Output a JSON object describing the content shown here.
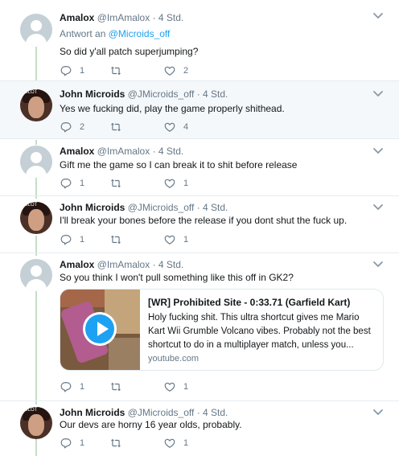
{
  "tweets": [
    {
      "name": "Amalox",
      "handle": "@ImAmalox",
      "time": "· 4 Std.",
      "reply_to_prefix": "Antwort an",
      "reply_to_handle": "@Microids_off",
      "text": "So did y'all patch superjumping?",
      "replies": "1",
      "retweets": "",
      "likes": "2"
    },
    {
      "name": "John Microids",
      "handle": "@JMicroids_off",
      "time": "· 4 Std.",
      "avatar_tag": "TSLOT",
      "text": "Yes we fucking did, play the game properly shithead.",
      "replies": "2",
      "retweets": "",
      "likes": "4"
    },
    {
      "name": "Amalox",
      "handle": "@ImAmalox",
      "time": "· 4 Std.",
      "text": "Gift me the game so I can break it to shit before release",
      "replies": "1",
      "retweets": "",
      "likes": "1"
    },
    {
      "name": "John Microids",
      "handle": "@JMicroids_off",
      "time": "· 4 Std.",
      "avatar_tag": "TSLOT",
      "text": "I'll break your bones before the release if you dont shut the fuck up.",
      "replies": "1",
      "retweets": "",
      "likes": "1"
    },
    {
      "name": "Amalox",
      "handle": "@ImAmalox",
      "time": "· 4 Std.",
      "text": "So you think I won't pull something like this off in GK2?",
      "card": {
        "title": "[WR] Prohibited Site - 0:33.71 (Garfield Kart)",
        "description": "Holy fucking shit. This ultra shortcut gives me Mario Kart Wii Grumble Volcano vibes. Probably not the best shortcut to do in a multiplayer match, unless you...",
        "domain": "youtube.com"
      },
      "replies": "1",
      "retweets": "",
      "likes": "1"
    },
    {
      "name": "John Microids",
      "handle": "@JMicroids_off",
      "time": "· 4 Std.",
      "avatar_tag": "TSLOT",
      "text": "Our devs are horny 16 year olds, probably.",
      "replies": "1",
      "retweets": "",
      "likes": "1"
    }
  ],
  "icons": {
    "reply": "reply-icon",
    "retweet": "retweet-icon",
    "like": "heart-icon",
    "menu": "chevron-down-icon",
    "play": "play-icon"
  },
  "colors": {
    "thread_line": "#c4dfc6",
    "highlight_bg": "#f5f8fa",
    "mention": "#1da1f2",
    "meta": "#657786",
    "divider": "#e6ecf0"
  }
}
